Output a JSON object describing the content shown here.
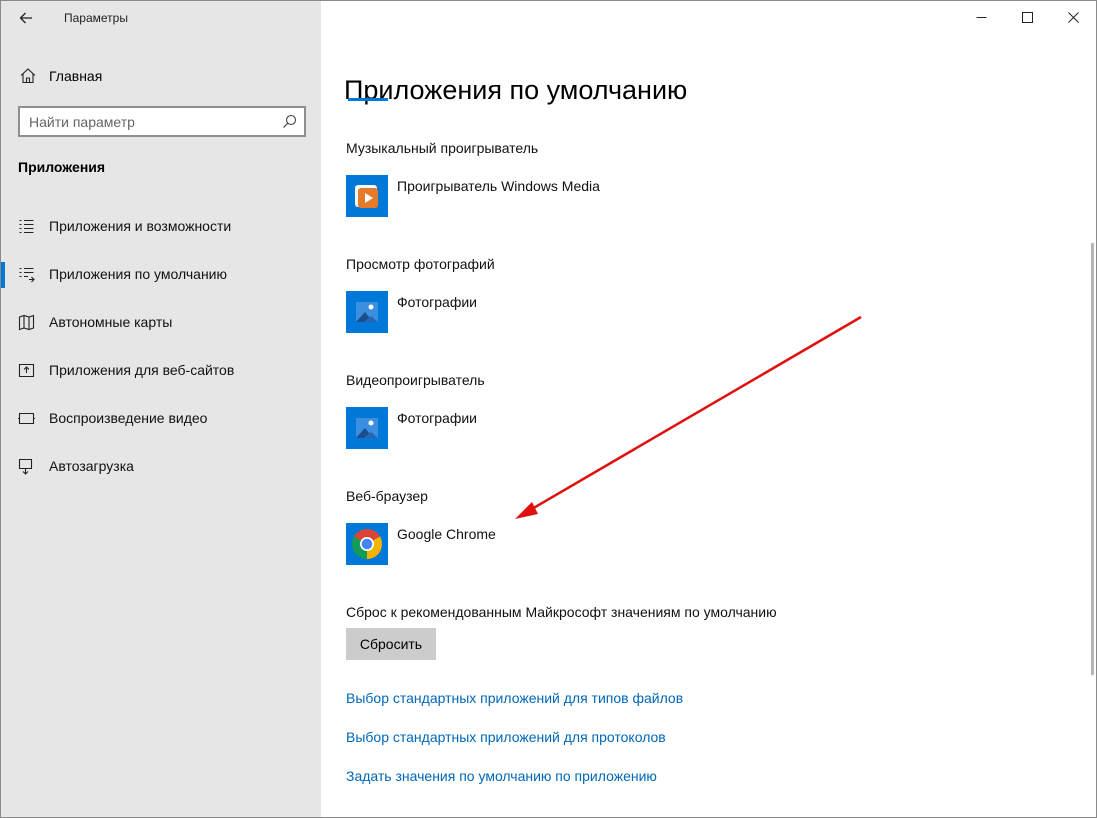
{
  "window": {
    "title": "Параметры"
  },
  "sidebar": {
    "home_label": "Главная",
    "search_placeholder": "Найти параметр",
    "section_title": "Приложения",
    "items": [
      {
        "label": "Приложения и возможности",
        "icon": "apps-features-icon",
        "active": false
      },
      {
        "label": "Приложения по умолчанию",
        "icon": "default-apps-icon",
        "active": true
      },
      {
        "label": "Автономные карты",
        "icon": "offline-maps-icon",
        "active": false
      },
      {
        "label": "Приложения для веб-сайтов",
        "icon": "apps-for-websites-icon",
        "active": false
      },
      {
        "label": "Воспроизведение видео",
        "icon": "video-playback-icon",
        "active": false
      },
      {
        "label": "Автозагрузка",
        "icon": "startup-icon",
        "active": false
      }
    ]
  },
  "main": {
    "page_title": "Приложения по умолчанию",
    "groups": [
      {
        "label": "Музыкальный проигрыватель",
        "app": "Проигрыватель Windows Media",
        "icon": "windows-media-player-icon"
      },
      {
        "label": "Просмотр фотографий",
        "app": "Фотографии",
        "icon": "photos-icon"
      },
      {
        "label": "Видеопроигрыватель",
        "app": "Фотографии",
        "icon": "photos-icon"
      },
      {
        "label": "Веб-браузер",
        "app": "Google Chrome",
        "icon": "chrome-icon"
      }
    ],
    "reset_label": "Сброс к рекомендованным Майкрософт значениям по умолчанию",
    "reset_button": "Сбросить",
    "links": [
      "Выбор стандартных приложений для типов файлов",
      "Выбор стандартных приложений для протоколов",
      "Задать значения по умолчанию по приложению"
    ]
  },
  "colors": {
    "accent": "#0078d7",
    "link": "#0067b8",
    "sidebar_bg": "#e6e6e6",
    "app_tile": "#0078d7",
    "annotation_arrow": "#e01010"
  }
}
